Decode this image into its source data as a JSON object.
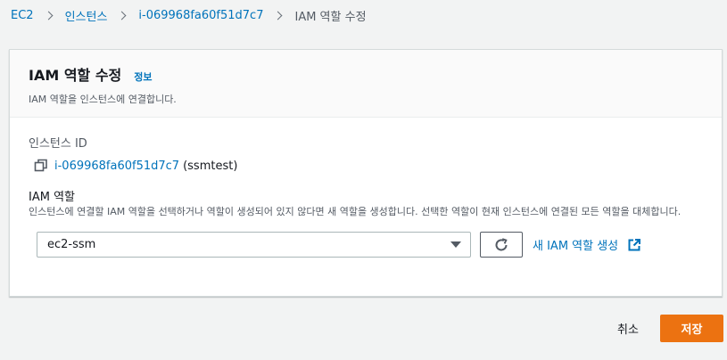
{
  "breadcrumb": {
    "items": [
      "EC2",
      "인스턴스",
      "i-069968fa60f51d7c7"
    ],
    "current": "IAM 역할 수정"
  },
  "panel": {
    "title": "IAM 역할 수정",
    "info": "정보",
    "description": "IAM 역할을 인스턴스에 연결합니다."
  },
  "instance": {
    "label": "인스턴스 ID",
    "id": "i-069968fa60f51d7c7",
    "name": "(ssmtest)"
  },
  "role": {
    "label": "IAM 역할",
    "description": "인스턴스에 연결할 IAM 역할을 선택하거나 역할이 생성되어 있지 않다면 새 역할을 생성합니다. 선택한 역할이 현재 인스턴스에 연결된 모든 역할을 대체합니다.",
    "selected": "ec2-ssm",
    "create_link": "새 IAM 역할 생성"
  },
  "footer": {
    "cancel": "취소",
    "save": "저장"
  },
  "colors": {
    "link": "#0073bb",
    "primary": "#ec7211"
  }
}
